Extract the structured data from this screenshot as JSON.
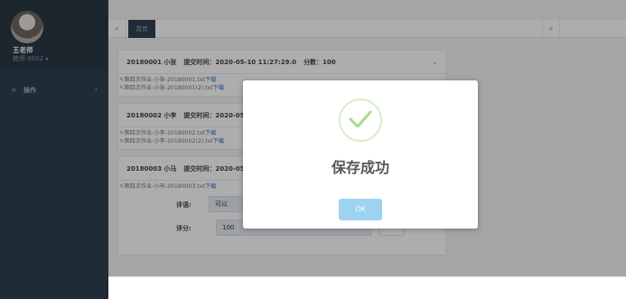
{
  "sidebar": {
    "username": "王老师",
    "role": "教师 0002",
    "nav_items": [
      {
        "label": "操作",
        "icon": "home-icon"
      }
    ]
  },
  "tabs": {
    "prev": "«",
    "home_label": "首页",
    "next": "»"
  },
  "submissions": [
    {
      "header": {
        "id_name": "20180001 小张",
        "submit_time": "提交时间：2020-05-10 11:27:29.0",
        "score": "分数：100"
      },
      "files": [
        {
          "name": "第四次作业-小张-20180001.txt",
          "download": "下载"
        },
        {
          "name": "第四次作业-小张-20180001(2).txt",
          "download": "下载"
        }
      ]
    },
    {
      "header": {
        "id_name": "20180002 小李",
        "submit_time": "提交时间：2020-05-1"
      },
      "files": [
        {
          "name": "第四次作业-小李-20180002.txt",
          "download": "下载"
        },
        {
          "name": "第四次作业-小李-20180002(2).txt",
          "download": "下载"
        }
      ]
    },
    {
      "header": {
        "id_name": "20180003 小马",
        "submit_time": "提交时间：2020-05-1"
      },
      "files": [
        {
          "name": "第四次作业-小马-20180003.txt",
          "download": "下载"
        }
      ],
      "form": {
        "comment_label": "评语:",
        "comment_value": "可以",
        "score_label": "评分:",
        "score_value": "100"
      }
    }
  ],
  "dialog": {
    "title": "保存成功",
    "ok_label": "OK",
    "icon": "check-icon",
    "accent": "#a5dc86",
    "button_color": "#9dd2f0"
  },
  "colors": {
    "sidebar": "#2f4050",
    "sidebar_profile": "#293846",
    "link": "#2a6fc0"
  }
}
